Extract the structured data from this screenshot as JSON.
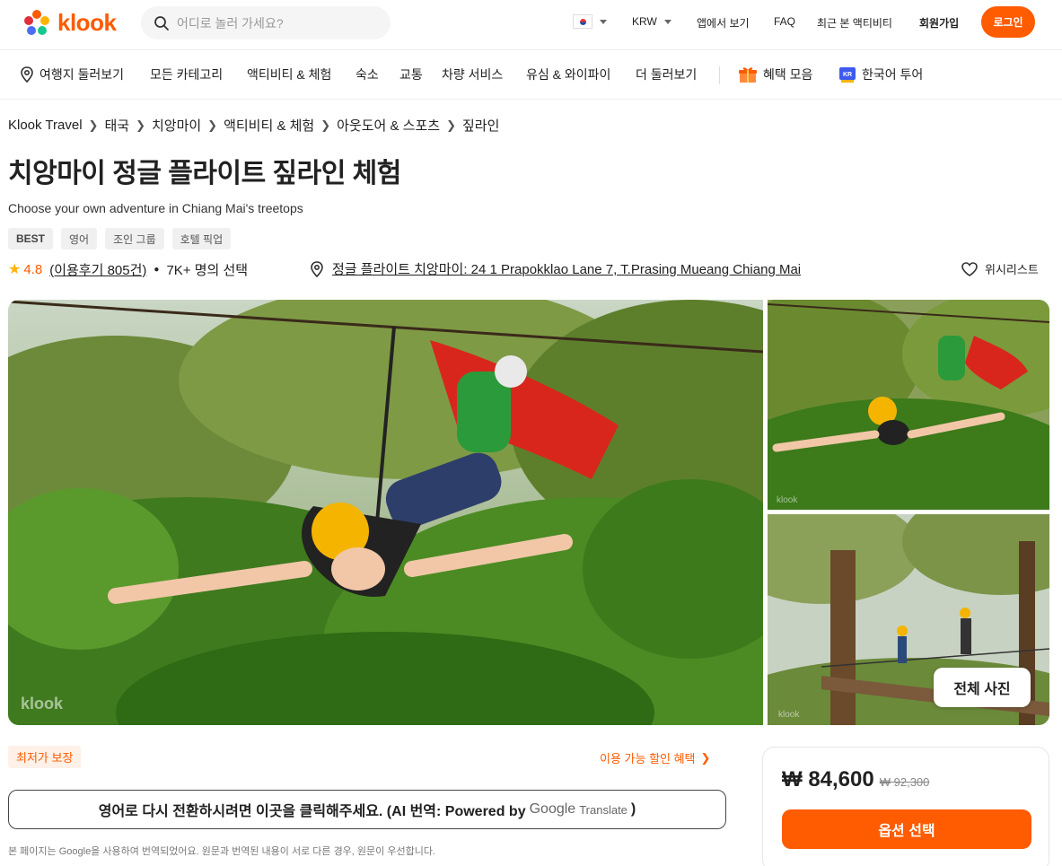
{
  "brand": {
    "name": "klook",
    "accent": "#ff5b00"
  },
  "header": {
    "search_placeholder": "어디로 놀러 가세요?",
    "currency": "KRW",
    "app_link": "앱에서 보기",
    "faq": "FAQ",
    "recent": "최근 본 액티비티",
    "signup": "회원가입",
    "login": "로그인"
  },
  "nav": {
    "items": [
      {
        "label": "여행지 둘러보기",
        "icon": "location-pin-icon"
      },
      {
        "label": "모든 카테고리"
      },
      {
        "label": "액티비티 & 체험"
      },
      {
        "label": "숙소"
      },
      {
        "label": "교통"
      },
      {
        "label": "차량 서비스"
      },
      {
        "label": "유심 & 와이파이"
      },
      {
        "label": "더 둘러보기"
      },
      {
        "label": "혜택 모음",
        "icon": "gift-icon"
      },
      {
        "label": "한국어 투어",
        "icon": "kr-tour-icon"
      }
    ]
  },
  "breadcrumb": [
    "Klook Travel",
    "태국",
    "치앙마이",
    "액티비티 & 체험",
    "아웃도어 & 스포츠",
    "짚라인"
  ],
  "product": {
    "title": "치앙마이 정글 플라이트 짚라인 체험",
    "subtitle": "Choose your own adventure in Chiang Mai's treetops",
    "tags": [
      "BEST",
      "영어",
      "조인 그룹",
      "호텔 픽업"
    ],
    "rating": "4.8",
    "reviews": "(이용후기 805건)",
    "booked": "7K+ 명의 선택",
    "location": "정글 플라이트 치앙마이: 24 1 Prapokklao Lane 7, T.Prasing Mueang Chiang Mai",
    "wishlist": "위시리스트"
  },
  "gallery": {
    "all_photos": "전체 사진",
    "watermark": "klook"
  },
  "offers": {
    "lowest_badge": "최저가 보장",
    "discount_link": "이용 가능 할인 혜택"
  },
  "translate": {
    "text": "영어로 다시 전환하시려면 이곳을 클릭해주세요. (AI 번역: Powered by",
    "google": "Google",
    "translate_word": "Translate",
    "close": ")",
    "notice": "본 페이지는 Google을 사용하여 번역되었어요. 원문과 번역된 내용이 서로 다른 경우, 원문이 우선합니다."
  },
  "pricing": {
    "price": "₩ 84,600",
    "original": "₩ 92,300",
    "select_option": "옵션 선택"
  }
}
